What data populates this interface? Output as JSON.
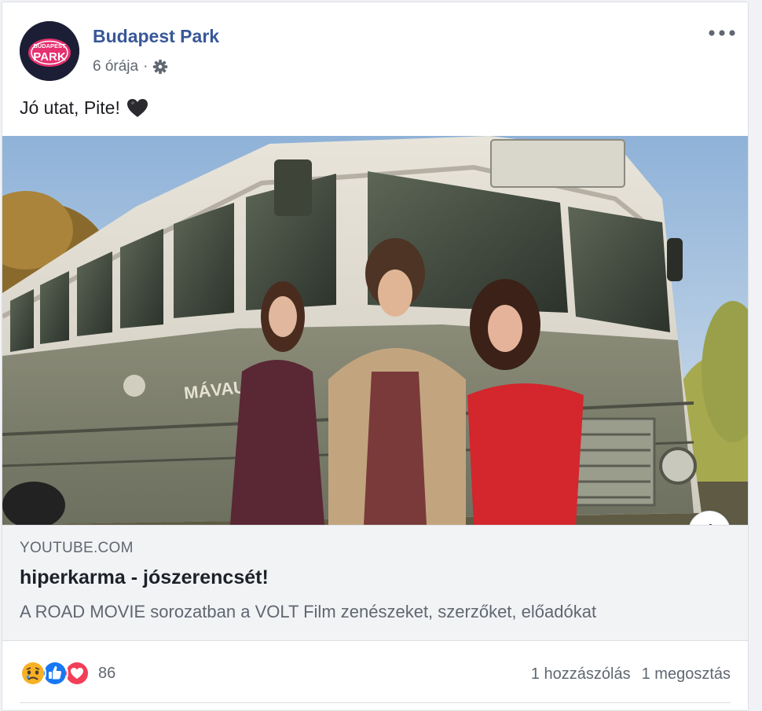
{
  "post": {
    "page_name": "Budapest Park",
    "avatar_text": [
      "BUDAPEST",
      "PARK"
    ],
    "timestamp": "6 órája",
    "separator": "·",
    "privacy_icon": "gear-icon",
    "more_icon": "more-options-icon",
    "text": "Jó utat, Pite!",
    "text_emoji": "black-heart-icon"
  },
  "link": {
    "domain": "YOUTUBE.COM",
    "title": "hiperkarma - jószerencsét!",
    "description": "A ROAD MOVIE sorozatban a VOLT Film zenészeket, szerzőket, előadókat",
    "info_icon": "info-icon",
    "info_label": "i",
    "bus_sign": "MÁVAUT"
  },
  "footer": {
    "reaction_icons": [
      "sad-icon",
      "like-icon",
      "love-icon"
    ],
    "reaction_count": "86",
    "comments": "1 hozzászólás",
    "shares": "1 megosztás"
  },
  "colors": {
    "link_blue": "#385898",
    "meta_gray": "#606770",
    "like_blue": "#1877f2",
    "love_red": "#f33e58",
    "avatar_bg": "#1c1e35",
    "avatar_pink": "#e6306f"
  }
}
